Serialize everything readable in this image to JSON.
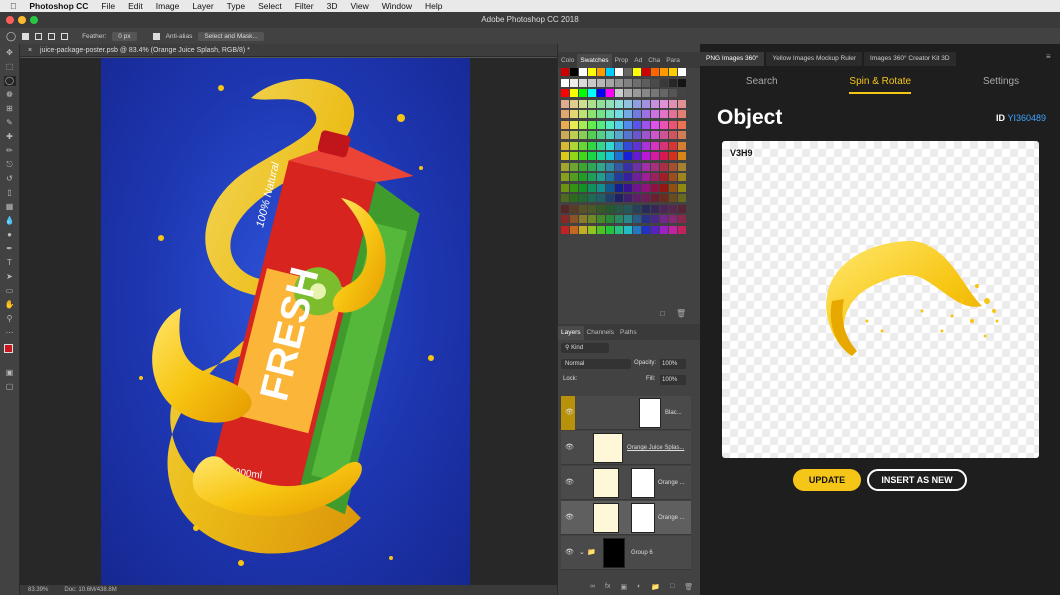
{
  "menubar": {
    "app_name": "Photoshop CC",
    "items": [
      "File",
      "Edit",
      "Image",
      "Layer",
      "Type",
      "Select",
      "Filter",
      "3D",
      "View",
      "Window",
      "Help"
    ]
  },
  "window_title": "Adobe Photoshop CC 2018",
  "options_bar": {
    "feather_label": "Feather:",
    "feather_value": "0 px",
    "antialias_label": "Anti-alias",
    "select_mask_label": "Select and Mask..."
  },
  "document": {
    "tab_title": "juice-package-poster.psb @ 83.4% (Orange Juice Splash, RGB/8) *",
    "zoom": "83.39%",
    "doc_size": "Doc: 10.6M/438.8M"
  },
  "swatch_panel": {
    "tabs": [
      "Colo",
      "Swatches",
      "Prop",
      "Ad",
      "Cha",
      "Para"
    ],
    "active_tab": "Swatches"
  },
  "layers_panel": {
    "tabs": [
      "Layers",
      "Channels",
      "Paths"
    ],
    "filter_kind": "Kind",
    "blend_mode": "Normal",
    "opacity_label": "Opacity:",
    "opacity_value": "100%",
    "lock_label": "Lock:",
    "fill_label": "Fill:",
    "fill_value": "100%",
    "layers": [
      {
        "name": "Blac..."
      },
      {
        "name": "Orange Juice Splas..."
      },
      {
        "name": "Orange ..."
      },
      {
        "name": "Orange ..."
      },
      {
        "name": "Group 6"
      }
    ]
  },
  "plugin": {
    "tabs": [
      "PNG Images 360°",
      "Yellow Images Mockup Ruler",
      "Images 360° Creator Kit 3D"
    ],
    "nav": [
      "Search",
      "Spin & Rotate",
      "Settings"
    ],
    "title": "Object",
    "id_label": "ID",
    "id_value": "YI360489",
    "preview_label": "V3H9",
    "update_label": "UPDATE",
    "insert_label": "INSERT AS NEW"
  },
  "poster": {
    "brand_text": "FRESH",
    "volume_text": "1000ml",
    "side_text": "100% Natural"
  },
  "colors": {
    "accent": "#f5c518",
    "link": "#3fa4ff",
    "poster_blue": "#1d36b0"
  }
}
